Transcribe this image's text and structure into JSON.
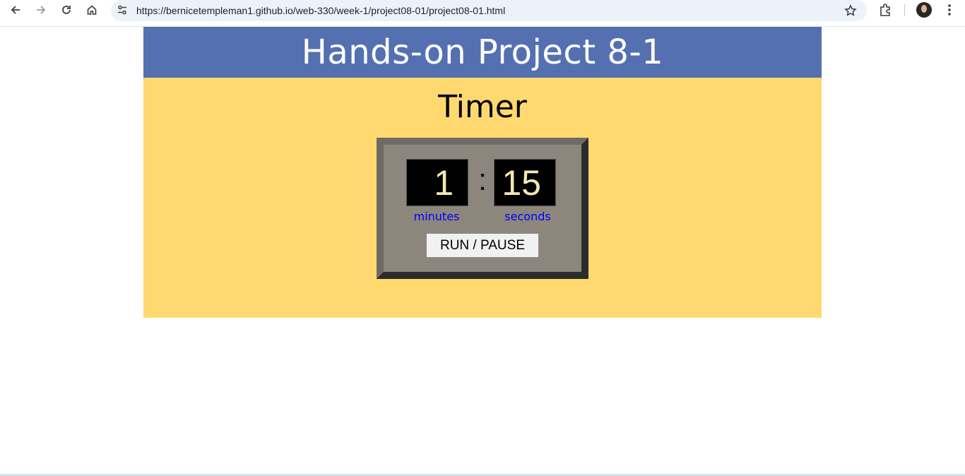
{
  "browser": {
    "url": "https://bernicetempleman1.github.io/web-330/week-1/project08-01/project08-01.html",
    "icons": [
      "back-icon",
      "forward-icon",
      "reload-icon",
      "home-icon",
      "tune-icon",
      "bookmark-star-icon",
      "extensions-icon",
      "avatar",
      "more-menu-icon"
    ]
  },
  "page": {
    "header_title": "Hands-on Project 8-1",
    "section_title": "Timer",
    "colors": {
      "header_bg": "#5470b0",
      "main_bg": "#ffd970",
      "timer_bg": "#8c867c",
      "digit_color": "#f4e8b2",
      "label_color": "#0000ff"
    }
  },
  "timer": {
    "minutes": "1",
    "separator": ":",
    "seconds": "15",
    "minutes_label": "minutes",
    "seconds_label": "seconds",
    "run_pause_label": "RUN / PAUSE"
  }
}
